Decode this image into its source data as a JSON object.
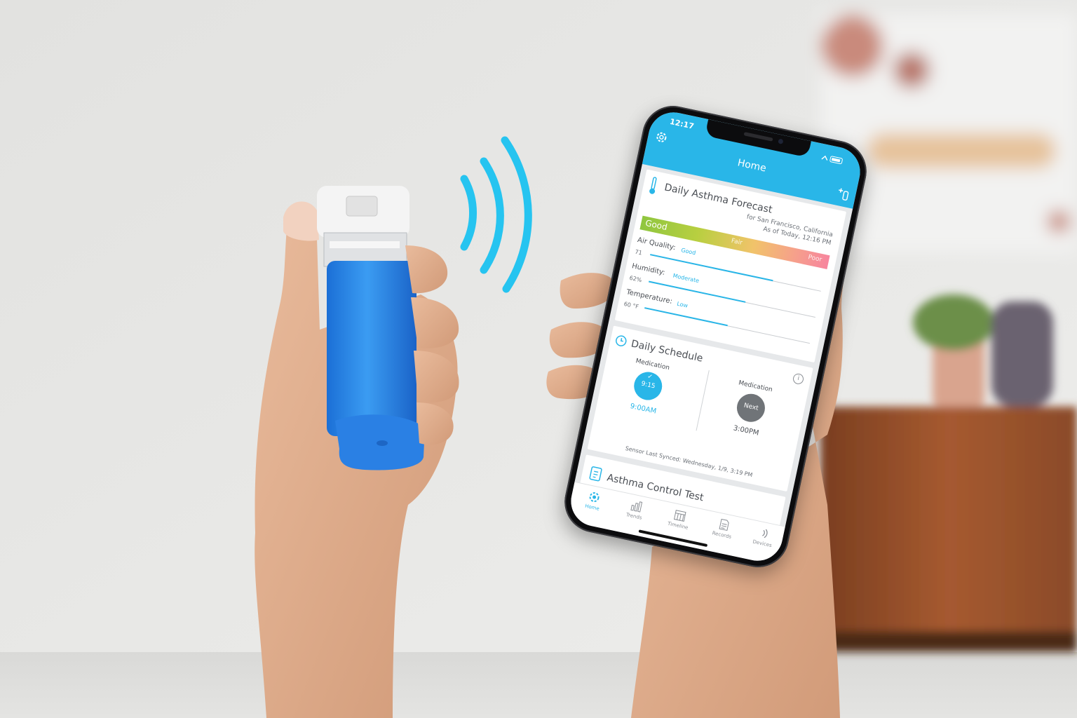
{
  "colors": {
    "accent": "#29b6e8",
    "inhaler": "#2e8fe8",
    "signal": "#26c4f0",
    "next": "#707478"
  },
  "status_bar": {
    "time": "12:17"
  },
  "app_bar": {
    "title": "Home",
    "settings_icon": "gear-icon",
    "add_device_icon": "add-device-icon"
  },
  "forecast": {
    "title": "Daily Asthma Forecast",
    "location": "for San Francisco, California",
    "as_of": "As of Today, 12:16 PM",
    "scale": {
      "good": "Good",
      "fair": "Fair",
      "poor": "Poor"
    },
    "metrics": [
      {
        "label": "Air Quality:",
        "value": "71",
        "status": "Good",
        "level": 0.72
      },
      {
        "label": "Humidity:",
        "value": "62%",
        "status": "Moderate",
        "level": 0.58
      },
      {
        "label": "Temperature:",
        "value": "60 °F",
        "status": "Low",
        "level": 0.5
      }
    ]
  },
  "schedule": {
    "title": "Daily Schedule",
    "items": [
      {
        "label": "Medication",
        "circle": "9:15",
        "time": "9:00AM",
        "state": "done"
      },
      {
        "label": "Medication",
        "circle": "Next",
        "time": "3:00PM",
        "state": "next"
      }
    ],
    "synced": "Sensor Last Synced: Wednesday, 1/9, 3:19 PM"
  },
  "control_test": {
    "title": "Asthma Control Test"
  },
  "tabs": [
    {
      "label": "Home",
      "icon": "home-icon",
      "active": true
    },
    {
      "label": "Trends",
      "icon": "trends-icon",
      "active": false
    },
    {
      "label": "Timeline",
      "icon": "timeline-icon",
      "active": false
    },
    {
      "label": "Records",
      "icon": "records-icon",
      "active": false
    },
    {
      "label": "Devices",
      "icon": "devices-icon",
      "active": false
    }
  ]
}
